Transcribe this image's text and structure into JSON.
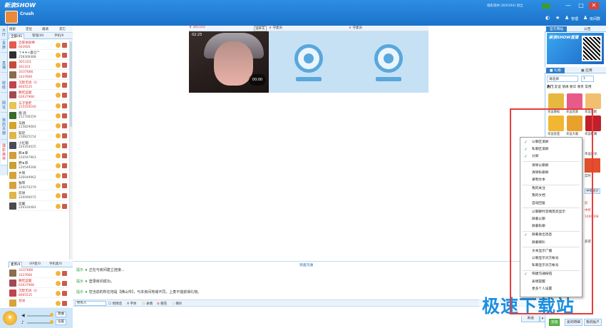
{
  "window": {
    "logo": "新浪SHOW",
    "room_name": "Crush",
    "user_info": "僵影森林 (800394) 退出",
    "controls": [
      "—",
      "□",
      "✕"
    ],
    "toolbar_labels": [
      "管理",
      "房间群"
    ]
  },
  "left_tabs": [
    "大厅",
    "贵族",
    "直播",
    "财经",
    "网址",
    "我的页面",
    "僵影森林"
  ],
  "user_toolbar": [
    "搜索",
    "定位",
    "邀请",
    "其它"
  ],
  "user_tabs": [
    {
      "label": "全部/41",
      "active": true
    },
    {
      "label": "管理/40",
      "active": false
    },
    {
      "label": "手机/0",
      "active": false
    }
  ],
  "users": [
    {
      "name": "迈家依很棒",
      "id": "603926",
      "red": true,
      "color": "#e35b4e"
    },
    {
      "name": "ㄚ✦✦+盘☺™",
      "id": "258306488",
      "red": false,
      "color": "#2f2f2f"
    },
    {
      "name": "301103",
      "id": "301103",
      "red": true,
      "color": "#c44d3a"
    },
    {
      "name": "3337666",
      "id": "3337666",
      "red": true,
      "color": "#8a6d4b"
    },
    {
      "name": "沉默无语（I）",
      "id": "8065535",
      "red": true,
      "color": "#c1434d"
    },
    {
      "name": "朝吃蓝腿",
      "id": "62637968",
      "red": true,
      "color": "#a14a55"
    },
    {
      "name": "与子偕老",
      "id": "215559160",
      "red": true,
      "color": "#e7c453"
    },
    {
      "name": "烟 酒",
      "id": "211706559",
      "red": false,
      "color": "#3a6a2a"
    },
    {
      "name": "马刚",
      "id": "215829083",
      "red": false,
      "color": "#d6a22a"
    },
    {
      "name": "知足",
      "id": "216825154",
      "red": false,
      "color": "#e0b54a"
    },
    {
      "name": "小红帽",
      "id": "220354025",
      "red": false,
      "color": "#4a4a5a"
    },
    {
      "name": "麻★菲",
      "id": "220547963",
      "red": false,
      "color": "#d69c3a"
    },
    {
      "name": "野★草",
      "id": "220549268",
      "red": false,
      "color": "#c8a032"
    },
    {
      "name": "乡情",
      "id": "226049962",
      "red": false,
      "color": "#d6a23a"
    },
    {
      "name": "独琴",
      "id": "226070279",
      "red": false,
      "color": "#d6a23a"
    },
    {
      "name": "前进",
      "id": "226090075",
      "red": false,
      "color": "#e0b54a"
    },
    {
      "name": "前翼",
      "id": "226104483",
      "red": false,
      "color": "#4a4a4a"
    }
  ],
  "user_tabs2": [
    {
      "label": "麦序/4",
      "active": true
    },
    {
      "label": "VIP麦/0",
      "active": false
    },
    {
      "label": "手机麦/0",
      "active": false
    }
  ],
  "mic_users": [
    {
      "name": "3337666",
      "id": "3337666",
      "red": true,
      "color": "#8a6d4b"
    },
    {
      "name": "朝吃蓝腿",
      "id": "62637968",
      "red": true,
      "color": "#a14a55"
    },
    {
      "name": "沉默无语（I）",
      "id": "8065535",
      "red": true,
      "color": "#c1434d"
    },
    {
      "name": "甘洲",
      "id": "",
      "red": true,
      "color": "#d6a23a"
    }
  ],
  "bottom_left": {
    "song": "歌曲",
    "settings": "设置"
  },
  "video": {
    "slot1_title": "301103",
    "slot1_time": "02:25",
    "slot1_overlay": "00:00",
    "slot1_btn": "送鲜花",
    "slot2_title": "守麦员",
    "slot3_title": "守麦员"
  },
  "chat": {
    "quick_chat": "快速沟通",
    "lines": [
      {
        "label": "提示",
        "text": "正在与房间建立连接..."
      },
      {
        "label": "提示",
        "text": "登录房间成功。"
      },
      {
        "label": "提示",
        "text": "您当前的所在地是【佛山市】，与本房间地域不同，上麦不能获得礼物。"
      }
    ]
  },
  "input_bar": {
    "target": "所有人",
    "private": "悄悄话",
    "font": "字体",
    "emoji": "表情",
    "flower": "赠花",
    "speaker": "喇叭"
  },
  "right": {
    "tabs": [
      {
        "label": "官方网站",
        "active": true
      },
      {
        "label": "公告",
        "active": false
      }
    ],
    "banner_text": "新浪SHOW直播",
    "gift_tabs": [
      {
        "label": "礼物",
        "active": true
      },
      {
        "label": "应用",
        "active": false
      }
    ],
    "gift_select": "请选择",
    "gift_qty": "1",
    "gift_cats": [
      "热门",
      "友谊",
      "情缘",
      "奢华",
      "尊贵",
      "常用"
    ],
    "gifts": [
      {
        "label": "幸运香槟",
        "color": "#e7b840"
      },
      {
        "label": "幸运花束",
        "color": "#e85a8a"
      },
      {
        "label": "幸运蛋糕",
        "color": "#f0c070"
      },
      {
        "label": "幸运金莲",
        "color": "#f2b632"
      },
      {
        "label": "幸运大富",
        "color": "#e9a12d"
      },
      {
        "label": "幸运红嘴",
        "color": "#c0202a"
      }
    ],
    "peek": [
      "幸运金龙",
      "实时",
      "中奖统计",
      "前",
      "中奖",
      "1000008",
      "获得"
    ],
    "bottom_btns": [
      "充值",
      "爱的明细",
      "我的账户"
    ],
    "send": "发送"
  },
  "context_menu": {
    "items": [
      {
        "label": "公聊区滚屏",
        "checked": true
      },
      {
        "label": "私聊区滚屏",
        "checked": true
      },
      {
        "label": "分屏",
        "checked": true
      },
      {
        "label": "清除公聊屏",
        "checked": false
      },
      {
        "label": "清除私聊屏",
        "checked": false
      },
      {
        "label": "录制文本",
        "checked": false
      },
      {
        "label": "我的关注",
        "checked": false
      },
      {
        "label": "我的文档",
        "checked": false
      },
      {
        "label": "自动回复",
        "checked": false
      },
      {
        "label": "公聊聊时忽略高亮显示",
        "checked": false
      },
      {
        "label": "屏蔽公聊",
        "checked": false
      },
      {
        "label": "屏蔽私聊",
        "checked": false
      },
      {
        "label": "屏蔽进出消息",
        "checked": true
      },
      {
        "label": "屏蔽喇叭",
        "checked": false
      },
      {
        "label": "文本显示广播",
        "checked": false
      },
      {
        "label": "公聊显示对方帐号",
        "checked": false
      },
      {
        "label": "私聊显示对方帐号",
        "checked": false
      },
      {
        "label": "快捷沟通按钮",
        "checked": true
      },
      {
        "label": "表情提醒",
        "checked": false
      },
      {
        "label": "更多个人设置",
        "checked": false
      }
    ]
  },
  "watermark": "极速下载站",
  "colors": {
    "title_bar": "#1e79cf",
    "accent_red": "#e83c3c",
    "check_green": "#2aa04a"
  }
}
